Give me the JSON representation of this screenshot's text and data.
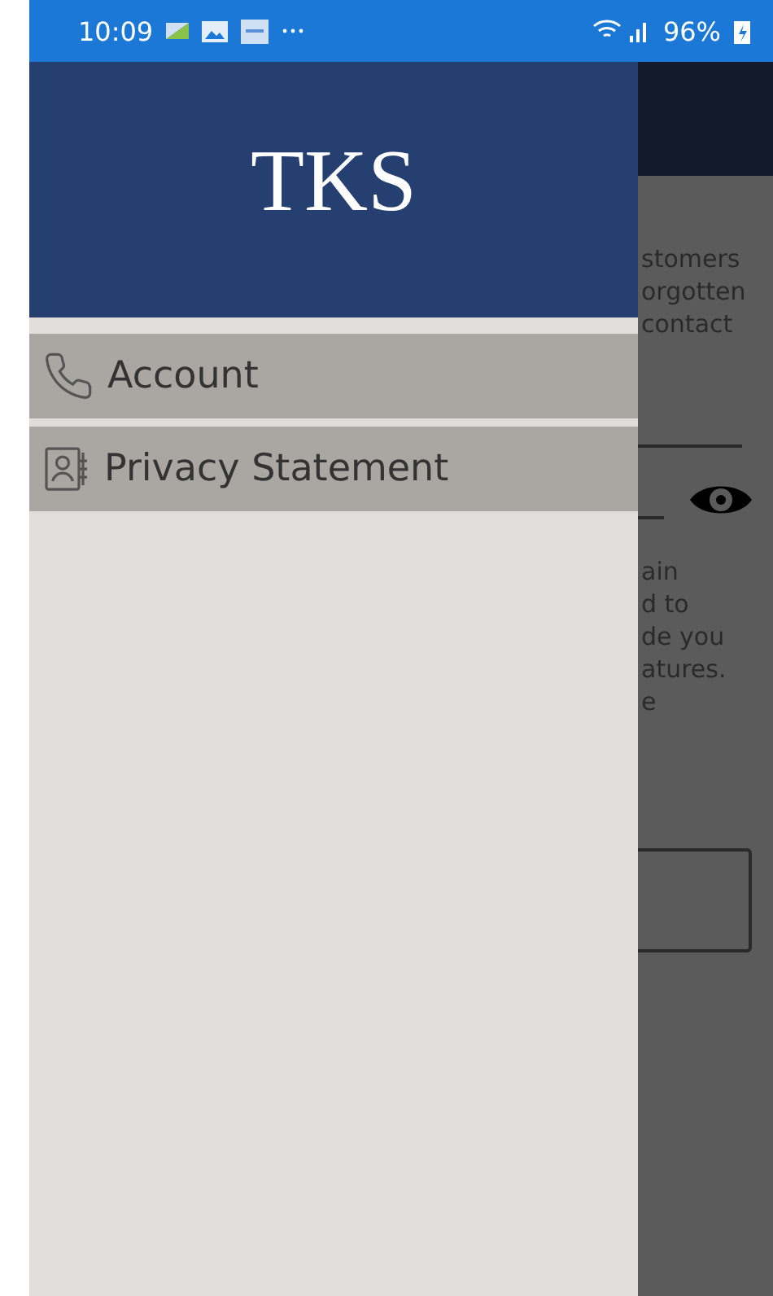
{
  "status_bar": {
    "time": "10:09",
    "battery": "96%"
  },
  "drawer": {
    "title": "TKS",
    "items": [
      {
        "label": "Account",
        "kind": "phone"
      },
      {
        "label": "Privacy Statement",
        "kind": "contact"
      }
    ]
  },
  "background_page": {
    "paragraph_1": [
      "stomers",
      "orgotten",
      "contact"
    ],
    "paragraph_2": [
      "ain",
      "d to",
      "de you",
      "atures.",
      "e"
    ]
  }
}
